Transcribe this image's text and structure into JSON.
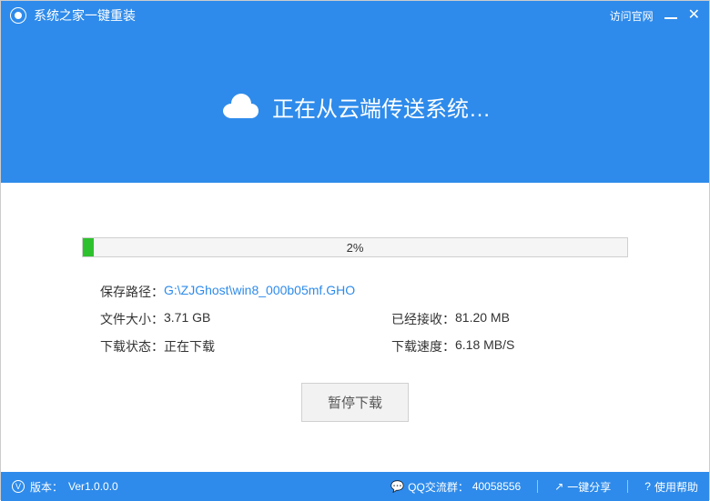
{
  "titlebar": {
    "app_title": "系统之家一键重装",
    "visit_site": "访问官网"
  },
  "banner": {
    "text": "正在从云端传送系统…"
  },
  "progress": {
    "percent_text": "2%",
    "percent_value": 2
  },
  "info": {
    "save_path_label": "保存路径：",
    "save_path_value": "G:\\ZJGhost\\win8_000b05mf.GHO",
    "file_size_label": "文件大小：",
    "file_size_value": "3.71 GB",
    "received_label": "已经接收：",
    "received_value": "81.20 MB",
    "status_label": "下载状态：",
    "status_value": "正在下载",
    "speed_label": "下载速度：",
    "speed_value": "6.18 MB/S"
  },
  "actions": {
    "pause_label": "暂停下载"
  },
  "footer": {
    "version_label": "版本：",
    "version_value": "Ver1.0.0.0",
    "qq_label": "QQ交流群：",
    "qq_value": "40058556",
    "share_label": "一键分享",
    "help_label": "使用帮助"
  }
}
